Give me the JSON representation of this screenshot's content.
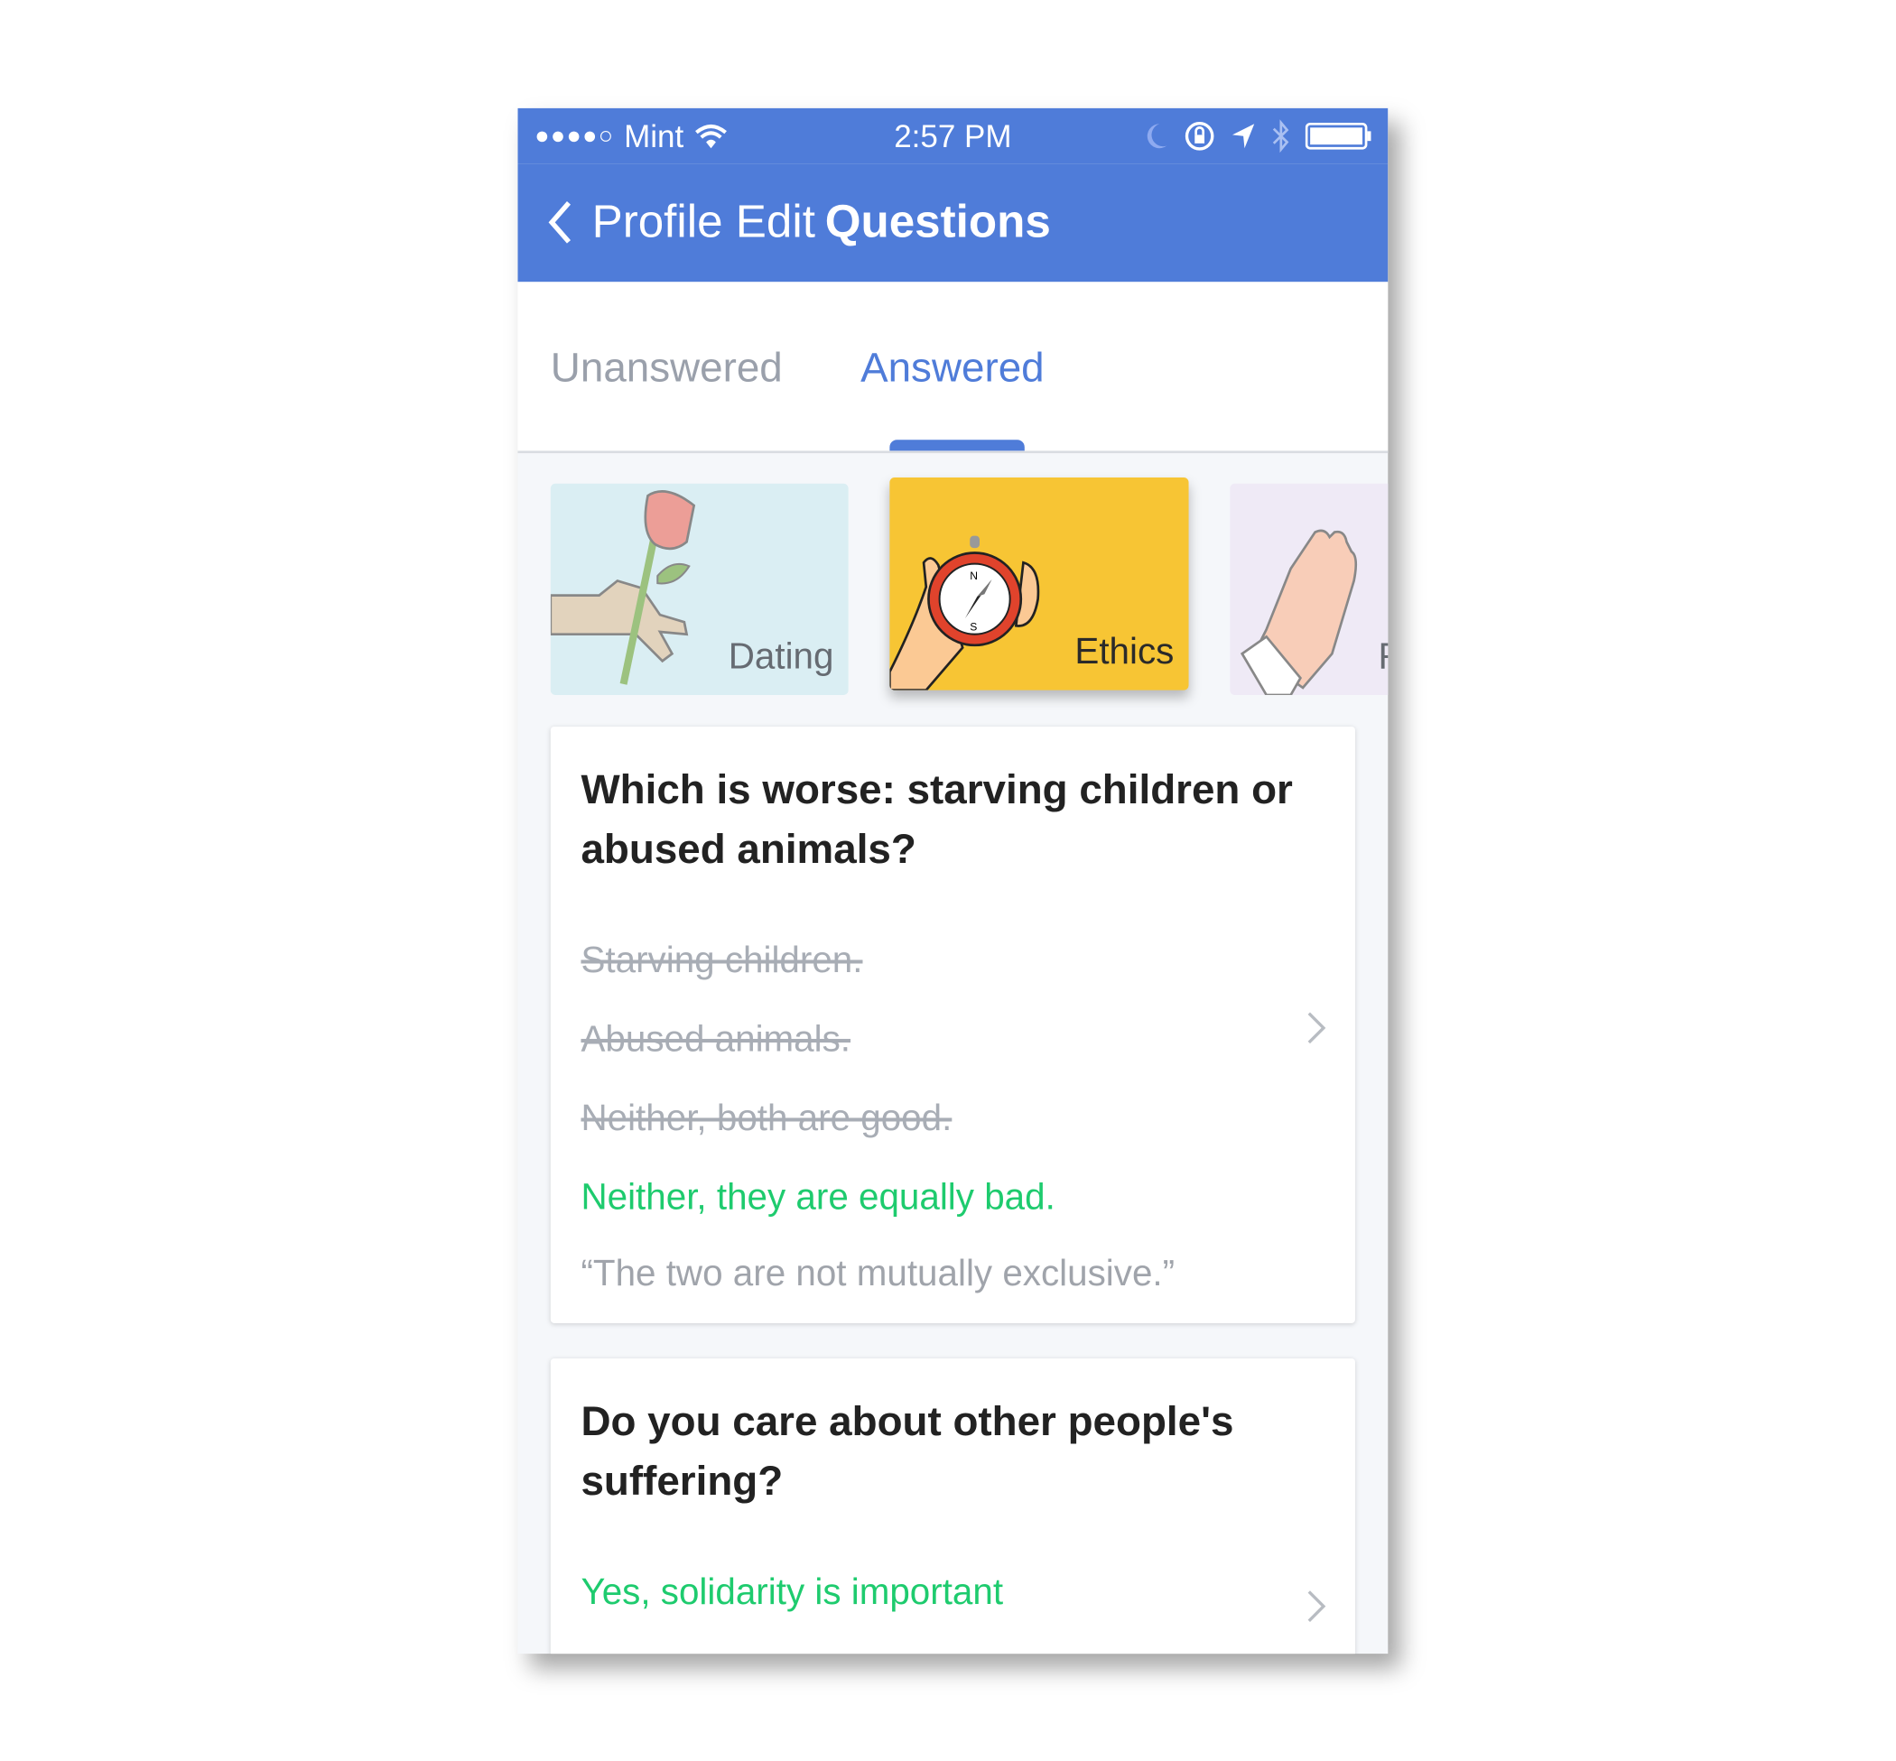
{
  "status_bar": {
    "signal": "●●●●○",
    "carrier": "Mint",
    "time": "2:57 PM"
  },
  "nav": {
    "back_label": "Profile Edit",
    "title": "Questions"
  },
  "tabs": [
    {
      "label": "Unanswered",
      "active": false
    },
    {
      "label": "Answered",
      "active": true
    }
  ],
  "categories": [
    {
      "label": "Dating",
      "color": "#daeef3",
      "icon": "rose-in-hand-icon"
    },
    {
      "label": "Ethics",
      "color": "#f7c534",
      "icon": "compass-in-hand-icon",
      "selected": true
    },
    {
      "label": "R",
      "color": "#efeaf6",
      "icon": "praying-hands-icon"
    }
  ],
  "questions": [
    {
      "question": "Which is worse: starving children or abused animals?",
      "answers": [
        {
          "text": "Starving children.",
          "selected": false
        },
        {
          "text": "Abused animals.",
          "selected": false
        },
        {
          "text": "Neither, both are good.",
          "selected": false
        },
        {
          "text": "Neither, they are equally bad.",
          "selected": true
        }
      ],
      "explanation": "“The two are not mutually exclusive.”"
    },
    {
      "question": "Do you care about other people's suffering?",
      "answers": [
        {
          "text": "Yes, solidarity is important",
          "selected": true
        }
      ]
    }
  ],
  "colors": {
    "accent": "#4f7cd9",
    "selected_answer": "#1ecb6e",
    "struck_answer": "#a8adb5"
  }
}
